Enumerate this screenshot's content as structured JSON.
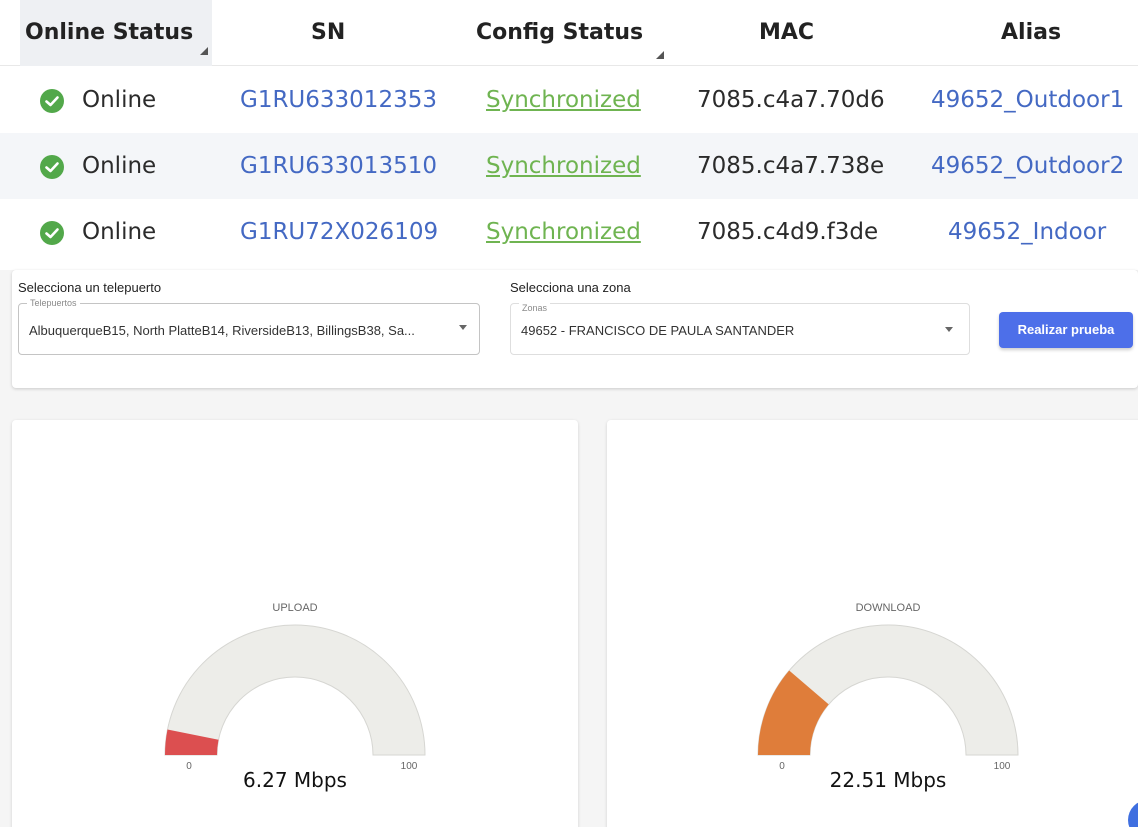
{
  "table": {
    "headers": {
      "online_status": "Online Status",
      "sn": "SN",
      "config_status": "Config Status",
      "mac": "MAC",
      "alias": "Alias"
    },
    "rows": [
      {
        "status": "Online",
        "sn": "G1RU633012353",
        "config": "Synchronized",
        "mac": "7085.c4a7.70d6",
        "alias": "49652_Outdoor1"
      },
      {
        "status": "Online",
        "sn": "G1RU633013510",
        "config": "Synchronized",
        "mac": "7085.c4a7.738e",
        "alias": "49652_Outdoor2"
      },
      {
        "status": "Online",
        "sn": "G1RU72X026109",
        "config": "Synchronized",
        "mac": "7085.c4d9.f3de",
        "alias": "49652_Indoor"
      }
    ],
    "status_icon": "check-circle-icon",
    "colors": {
      "online": "#52a84a",
      "link": "#4469c3",
      "synced": "#6fb451"
    }
  },
  "filters": {
    "teleport": {
      "label": "Selecciona un telepuerto",
      "legend": "Telepuertos",
      "value": "AlbuquerqueB15, North PlatteB14, RiversideB13, BillingsB38, Sa..."
    },
    "zone": {
      "label": "Selecciona una zona",
      "legend": "Zonas",
      "value": "49652 - FRANCISCO DE PAULA SANTANDER"
    },
    "submit_label": "Realizar prueba",
    "accent": "#4d6fe9"
  },
  "gauges": [
    {
      "title": "UPLOAD",
      "value": 6.27,
      "display": "6.27 Mbps",
      "min": 0,
      "max": 100,
      "min_label": "0",
      "max_label": "100",
      "color": "#dc4f50"
    },
    {
      "title": "DOWNLOAD",
      "value": 22.51,
      "display": "22.51 Mbps",
      "min": 0,
      "max": 100,
      "min_label": "0",
      "max_label": "100",
      "color": "#df7d3a"
    }
  ]
}
